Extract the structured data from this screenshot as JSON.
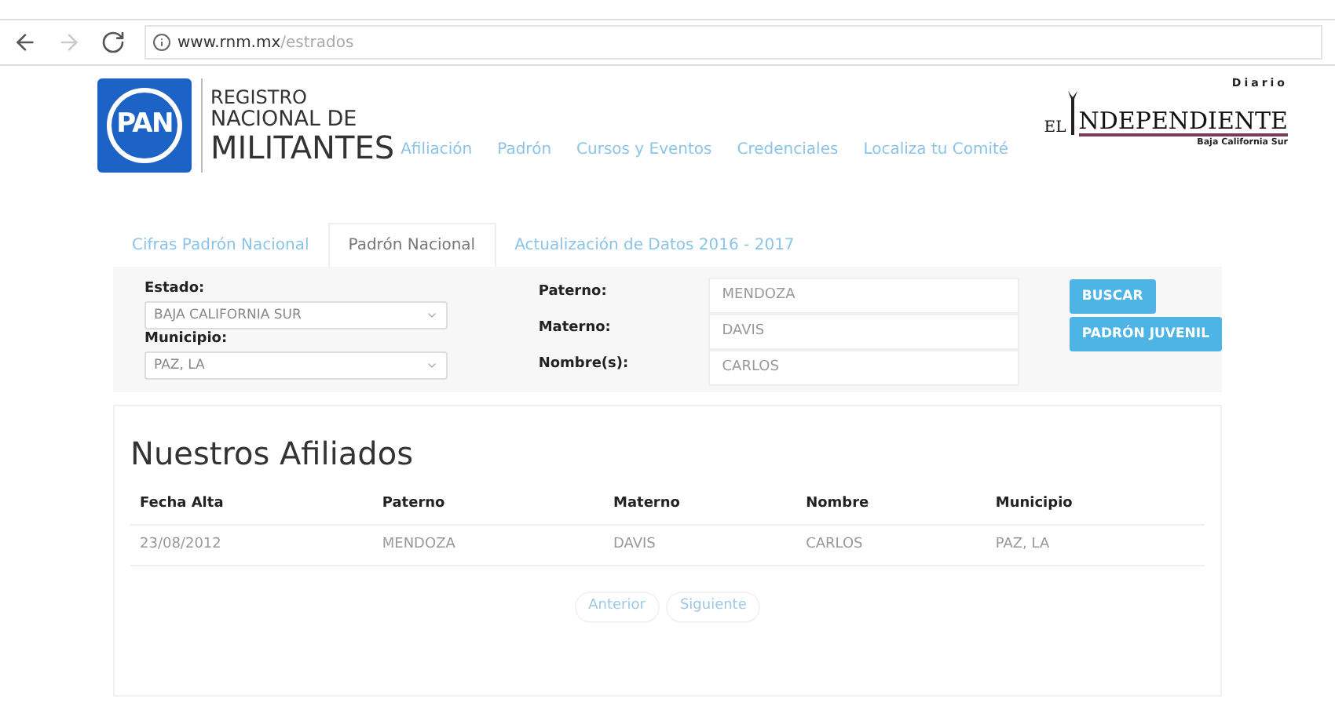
{
  "browser": {
    "url_host": "www.rnm.mx",
    "url_path": "/estrados"
  },
  "logo": {
    "badge": "PAN",
    "line1": "REGISTRO",
    "line2": "NACIONAL DE",
    "line3": "MILITANTES"
  },
  "nav": [
    "Afiliación",
    "Padrón",
    "Cursos y Eventos",
    "Credenciales",
    "Localiza tu Comité"
  ],
  "watermark_logo": {
    "top": "Diario",
    "el": "EL",
    "name": "NDEPENDIENTE",
    "sub": "Baja California Sur"
  },
  "tabs": [
    {
      "label": "Cifras Padrón Nacional",
      "selected": false
    },
    {
      "label": "Padrón Nacional",
      "selected": true
    },
    {
      "label": "Actualización de Datos 2016 - 2017",
      "selected": false
    }
  ],
  "form": {
    "selects": [
      {
        "label": "Estado:",
        "value": "BAJA CALIFORNIA SUR"
      },
      {
        "label": "Municipio:",
        "value": "PAZ, LA"
      }
    ],
    "inputs": [
      {
        "label": "Paterno:",
        "value": "MENDOZA"
      },
      {
        "label": "Materno:",
        "value": "DAVIS"
      },
      {
        "label": "Nombre(s):",
        "value": "CARLOS"
      }
    ],
    "buttons": [
      "BUSCAR",
      "PADRÓN JUVENIL"
    ]
  },
  "results": {
    "title": "Nuestros Afiliados",
    "columns": [
      "Fecha Alta",
      "Paterno",
      "Materno",
      "Nombre",
      "Municipio"
    ],
    "rows": [
      [
        "23/08/2012",
        "MENDOZA",
        "DAVIS",
        "CARLOS",
        "PAZ, LA"
      ]
    ],
    "pager": [
      "Anterior",
      "Siguiente"
    ]
  }
}
